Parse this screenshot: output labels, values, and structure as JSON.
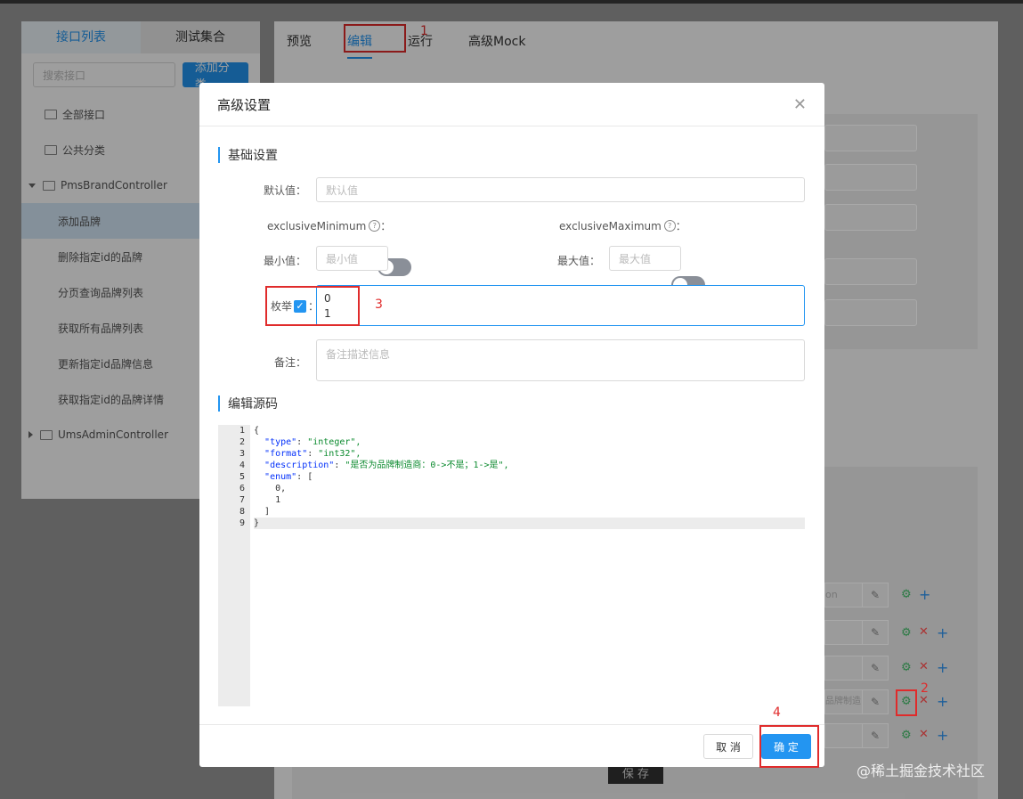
{
  "left_panel": {
    "tabs": [
      {
        "label": "接口列表"
      },
      {
        "label": "测试集合"
      }
    ],
    "search_placeholder": "搜索接口",
    "add_category_label": "添加分类",
    "tree": [
      {
        "label": "全部接口"
      },
      {
        "label": "公共分类"
      },
      {
        "label": "PmsBrandController"
      },
      {
        "label": "添加品牌"
      },
      {
        "label": "删除指定id的品牌"
      },
      {
        "label": "分页查询品牌列表"
      },
      {
        "label": "获取所有品牌列表"
      },
      {
        "label": "更新指定id品牌信息"
      },
      {
        "label": "获取指定id的品牌详情"
      },
      {
        "label": "UmsAdminController"
      }
    ]
  },
  "right_panel": {
    "tabs": [
      {
        "label": "预览"
      },
      {
        "label": "编辑"
      },
      {
        "label": "运行"
      },
      {
        "label": "高级Mock"
      }
    ],
    "save_label": "保 存"
  },
  "annotations": {
    "n1": "1",
    "n2": "2",
    "n3": "3",
    "n4": "4"
  },
  "modal": {
    "title": "高级设置",
    "section_basic": "基础设置",
    "default_label": "默认值：",
    "default_placeholder": "默认值",
    "exclusive_min_label": "exclusiveMinimum",
    "exclusive_max_label": "exclusiveMaximum",
    "colon": "：",
    "min_label": "最小值：",
    "min_placeholder": "最小值",
    "max_label": "最大值：",
    "max_placeholder": "最大值",
    "enum_label": "枚举",
    "enum_value": "0\n1",
    "remark_label": "备注：",
    "remark_placeholder": "备注描述信息",
    "section_source": "编辑源码",
    "code_lines": [
      {
        "num": "1",
        "text": "{"
      },
      {
        "num": "2",
        "key": "\"type\"",
        "value": "\"integer\","
      },
      {
        "num": "3",
        "key": "\"format\"",
        "value": "\"int32\","
      },
      {
        "num": "4",
        "key": "\"description\"",
        "value": "\"是否为品牌制造商：0->不是；1->是\","
      },
      {
        "num": "5",
        "key": "\"enum\"",
        "value": "["
      },
      {
        "num": "6",
        "text": "    0,"
      },
      {
        "num": "7",
        "text": "    1"
      },
      {
        "num": "8",
        "text": "  ]"
      },
      {
        "num": "9",
        "text": "}"
      }
    ],
    "cancel_label": "取 消",
    "ok_label": "确 定"
  },
  "watermark": "@稀土掘金技术社区",
  "bg_fields": [
    "on",
    "",
    "",
    "品牌制造"
  ],
  "colors": {
    "accent": "#2395f1",
    "annotation": "#e02b2b"
  }
}
